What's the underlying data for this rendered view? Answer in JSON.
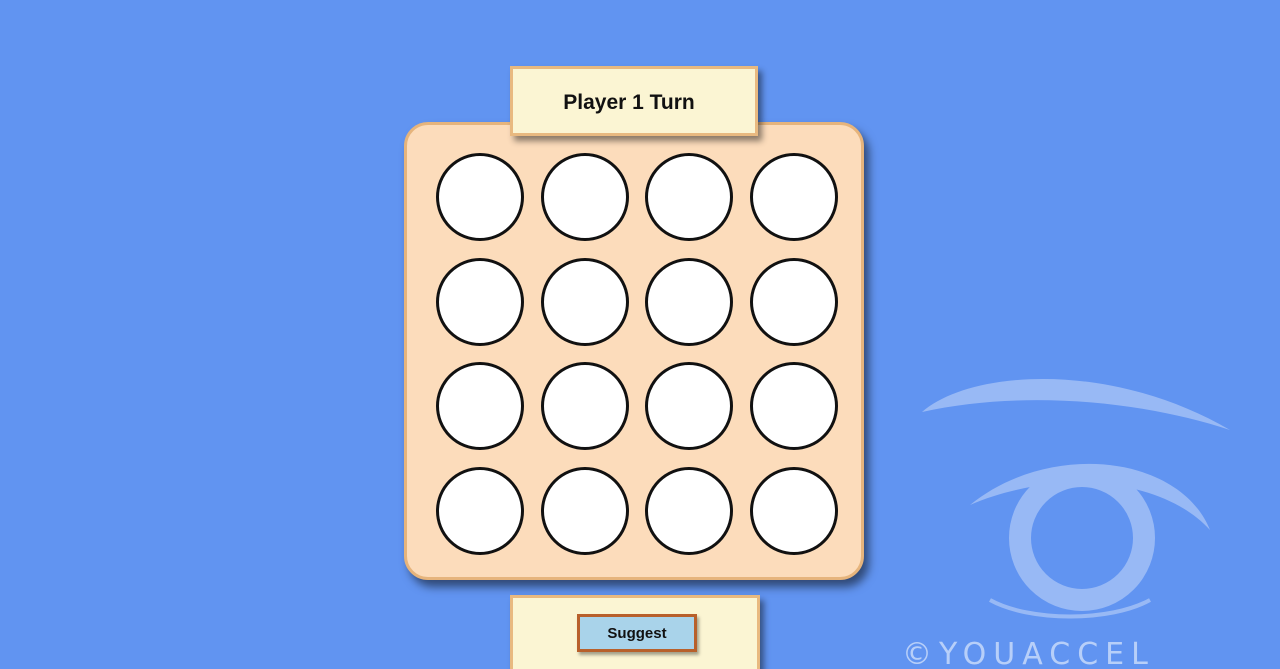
{
  "header": {
    "turn_label": "Player 1 Turn"
  },
  "board": {
    "rows": 4,
    "columns": 4,
    "cells": [
      "empty",
      "empty",
      "empty",
      "empty",
      "empty",
      "empty",
      "empty",
      "empty",
      "empty",
      "empty",
      "empty",
      "empty",
      "empty",
      "empty",
      "empty",
      "empty"
    ]
  },
  "controls": {
    "suggest_label": "Suggest"
  },
  "watermark": {
    "text": "©YOUACCEL",
    "logo": "eye-logo"
  },
  "colors": {
    "background": "#6194f1",
    "board": "#fcdcbb",
    "panel": "#fbf5d3",
    "button": "#a9d3ea",
    "button_border": "#b8602b",
    "cell": "#ffffff"
  }
}
